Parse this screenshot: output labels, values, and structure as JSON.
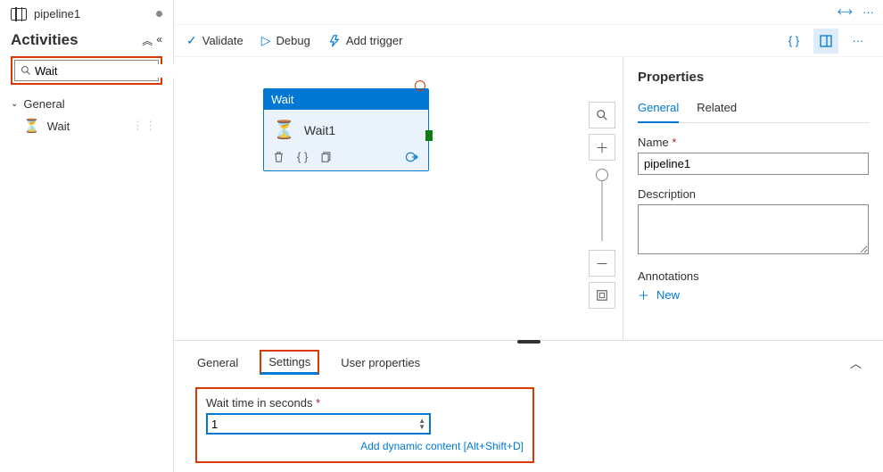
{
  "sidebar": {
    "tab_title": "pipeline1",
    "header": "Activities",
    "search_value": "Wait",
    "category": "General",
    "item_label": "Wait"
  },
  "toolbar": {
    "validate": "Validate",
    "debug": "Debug",
    "add_trigger": "Add trigger"
  },
  "canvas": {
    "node_type": "Wait",
    "node_name": "Wait1"
  },
  "properties": {
    "title": "Properties",
    "tabs": {
      "general": "General",
      "related": "Related"
    },
    "name_label": "Name",
    "name_value": "pipeline1",
    "desc_label": "Description",
    "desc_value": "",
    "ann_label": "Annotations",
    "ann_new": "New"
  },
  "bottom": {
    "tabs": {
      "general": "General",
      "settings": "Settings",
      "user_props": "User properties"
    },
    "wait_label": "Wait time in seconds",
    "wait_value": "1",
    "dynamic_hint": "Add dynamic content [Alt+Shift+D]"
  }
}
